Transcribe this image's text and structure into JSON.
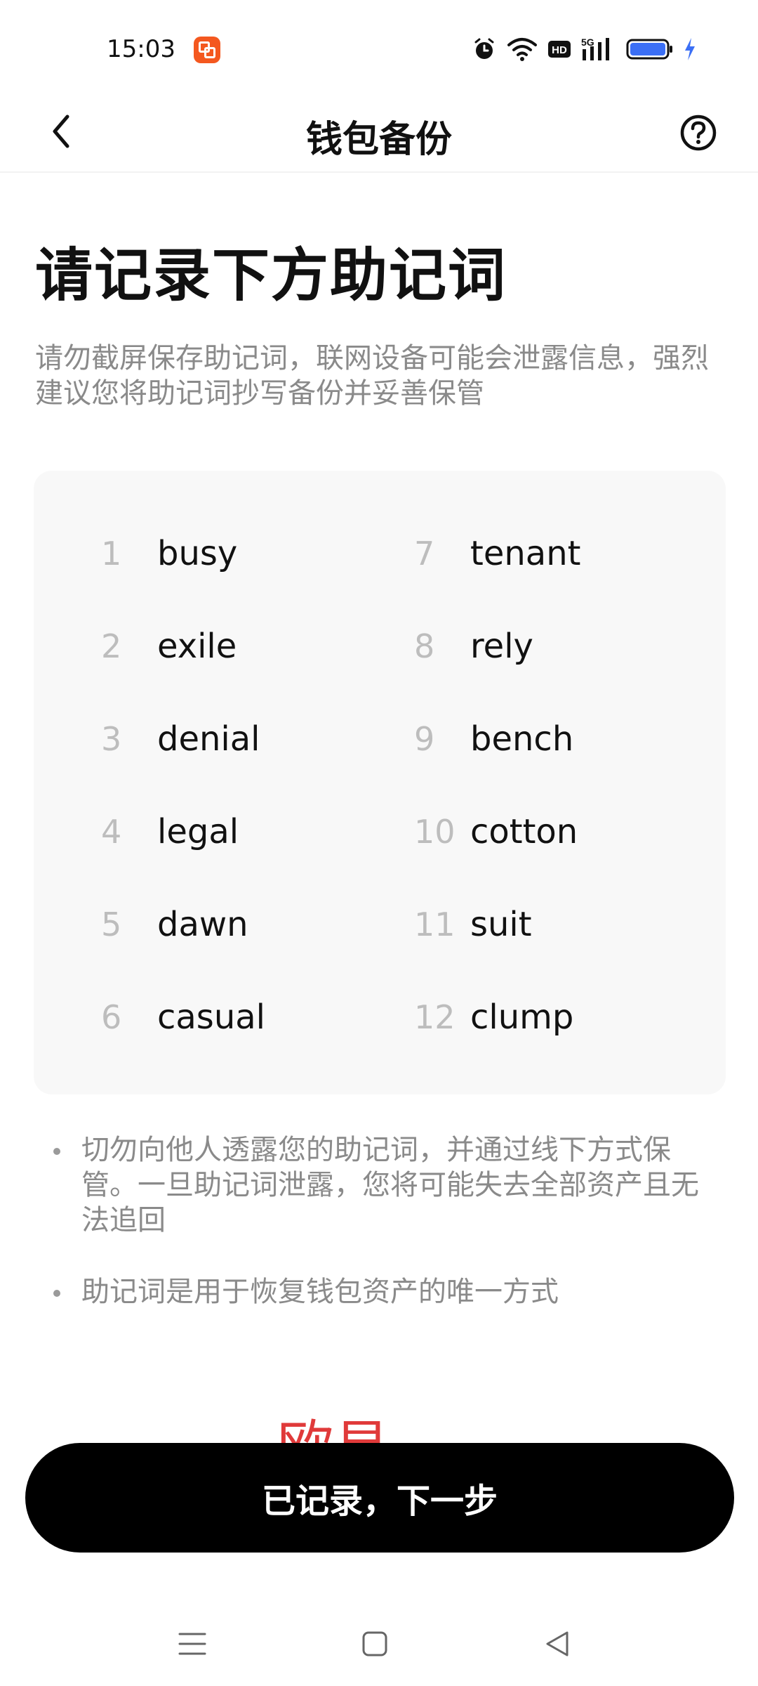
{
  "status_bar": {
    "time": "15:03",
    "icons": [
      "app-badge-icon",
      "alarm-icon",
      "wifi-icon",
      "hd-icon",
      "5g-signal-icon",
      "battery-icon",
      "charging-icon"
    ]
  },
  "nav": {
    "title": "钱包备份",
    "back_icon": "chevron-left-icon",
    "help_icon": "question-circle-icon"
  },
  "heading": "请记录下方助记词",
  "description": "请勿截屏保存助记词，联网设备可能会泄露信息，强烈建议您将助记词抄写备份并妥善保管",
  "words": [
    {
      "num": "1",
      "word": "busy"
    },
    {
      "num": "2",
      "word": "exile"
    },
    {
      "num": "3",
      "word": "denial"
    },
    {
      "num": "4",
      "word": "legal"
    },
    {
      "num": "5",
      "word": "dawn"
    },
    {
      "num": "6",
      "word": "casual"
    },
    {
      "num": "7",
      "word": "tenant"
    },
    {
      "num": "8",
      "word": "rely"
    },
    {
      "num": "9",
      "word": "bench"
    },
    {
      "num": "10",
      "word": "cotton"
    },
    {
      "num": "11",
      "word": "suit"
    },
    {
      "num": "12",
      "word": "clump"
    }
  ],
  "tips": [
    "切勿向他人透露您的助记词，并通过线下方式保管。一旦助记词泄露，您将可能失去全部资产且无法追回",
    "助记词是用于恢复钱包资产的唯一方式"
  ],
  "watermark": "欧易",
  "primary_button": "已记录，下一步",
  "colors": {
    "accent_button": "#000000",
    "watermark": "#e03a3a",
    "app_badge": "#f4581f",
    "battery": "#3b6ff5"
  },
  "system_nav": [
    "menu-icon",
    "home-icon",
    "back-triangle-icon"
  ]
}
